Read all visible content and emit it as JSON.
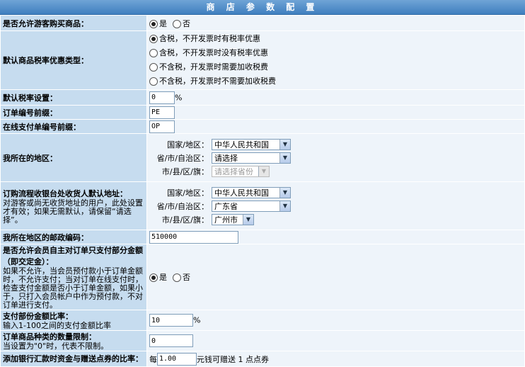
{
  "title": "商 店 参 数 配 置",
  "rows": {
    "guest": {
      "label": "是否允许游客购买商品：",
      "opt_yes": "是",
      "opt_no": "否"
    },
    "tax_type": {
      "label": "默认商品税率优惠类型：",
      "options": [
        "含税，不开发票时有税率优惠",
        "含税，不开发票时没有税率优惠",
        "不含税，开发票时需要加收税费",
        "不含税，开发票时不需要加收税费"
      ]
    },
    "tax_rate": {
      "label": "默认税率设置：",
      "value": "0",
      "unit": "%"
    },
    "order_prefix": {
      "label": "订单编号前缀：",
      "value": "PE"
    },
    "pay_prefix": {
      "label": "在线支付单编号前缀：",
      "value": "OP"
    },
    "region": {
      "label": "我所在的地区：",
      "country_label": "国家/地区：",
      "country": "中华人民共和国",
      "province_label": "省/市/自治区：",
      "province": "请选择",
      "city_label": "市/县/区/旗：",
      "city": "请选择省份"
    },
    "receiver": {
      "label": "订购流程收银台处收货人默认地址：",
      "desc": "对游客或尚无收货地址的用户，此处设置才有效；如果无需默认，请保留“请选择”。",
      "country_label": "国家/地区：",
      "country": "中华人民共和国",
      "province_label": "省/市/自治区：",
      "province": "广东省",
      "city_label": "市/县/区/旗：",
      "city": "广州市"
    },
    "postcode": {
      "label": "我所在地区的邮政编码：",
      "value": "510000"
    },
    "partial": {
      "label": "是否允许会员自主对订单只支付部分金额（即交定金）：",
      "desc": "如果不允许，当会员预付款小于订单金额时，不允许支付；当对订单在线支付时，检查支付金额是否小于订单金额，如果小于，只打入会员帐户中作为预付款，不对订单进行支付。",
      "opt_yes": "是",
      "opt_no": "否"
    },
    "partial_ratio": {
      "label": "支付部份金额比率：",
      "desc": "输入1-100之间的支付金额比率",
      "value": "10",
      "unit": "%"
    },
    "kind_limit": {
      "label": "订单商品种类的数量限制：",
      "desc": "当设置为\"0\"时，代表不限制。",
      "value": "0"
    },
    "coupon": {
      "label": "添加银行汇款时资金与赠送点券的比率：",
      "prefix": "每",
      "value": "1.00",
      "suffix": "元钱可赠送 1 点点券"
    }
  }
}
